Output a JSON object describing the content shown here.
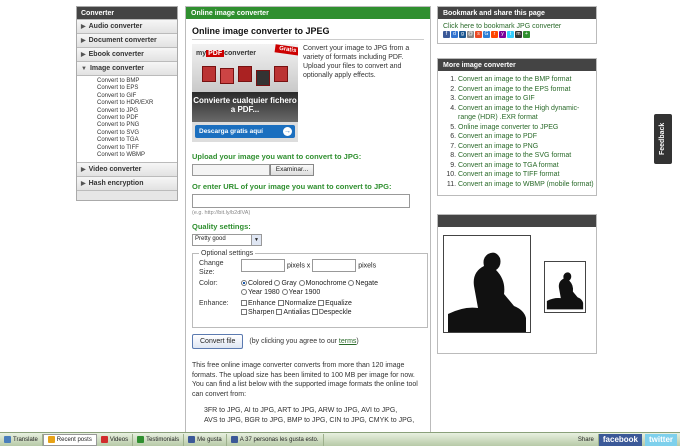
{
  "sidebar": {
    "header": "Converter",
    "items": [
      {
        "label": "Audio converter",
        "arrow": "▶"
      },
      {
        "label": "Document converter",
        "arrow": "▶"
      },
      {
        "label": "Ebook converter",
        "arrow": "▶"
      },
      {
        "label": "Image converter",
        "arrow": "▼"
      }
    ],
    "sub_items": [
      "Convert to BMP",
      "Convert to EPS",
      "Convert to GIF",
      "Convert to HDR/EXR",
      "Convert to JPG",
      "Convert to PDF",
      "Convert to PNG",
      "Convert to SVG",
      "Convert to TGA",
      "Convert to TIFF",
      "Convert to WBMP"
    ],
    "items_after": [
      {
        "label": "Video converter",
        "arrow": "▶"
      },
      {
        "label": "Hash encryption",
        "arrow": "▶"
      }
    ]
  },
  "main": {
    "header": "Online image converter",
    "title": "Online image converter to JPEG",
    "ad": {
      "logo_pre": "my",
      "logo_pdf": "PDF",
      "logo_post": "converter",
      "ribbon": "Gratis",
      "headline": "Convierte cualquier fichero a PDF...",
      "button": "Descarga gratis aquí",
      "button_icon": "→"
    },
    "promo_text": "Convert your image to JPG from a variety of formats including PDF. Upload your files to convert and optionally apply effects.",
    "upload_label": "Upload your image you want to convert to JPG:",
    "browse_button": "Examinar...",
    "url_label": "Or enter URL of your image you want to convert to JPG:",
    "url_hint": "(e.g. http://bit.ly/b2dlVA)",
    "quality_label": "Quality settings:",
    "quality_value": "Pretty good",
    "quality_arrow": "▼",
    "options": {
      "legend": "Optional settings",
      "change_size_label": "Change Size:",
      "pixels_x": "pixels x",
      "pixels": "pixels",
      "color_label": "Color:",
      "colors": [
        "Colored",
        "Gray",
        "Monochrome",
        "Negate",
        "Year 1980",
        "Year 1900"
      ],
      "enhance_label": "Enhance:",
      "enhance": [
        "Enhance",
        "Normalize",
        "Equalize",
        "Sharpen",
        "Antialias",
        "Despeckle"
      ]
    },
    "convert_button": "Convert file",
    "agree_pre": "(by clicking you agree to our",
    "agree_link": "terms",
    "agree_post": ")",
    "description": "This free online image converter converts from more than 120 image formats. The upload size has been limited to 100 MB per image for now. You can find a list below with the supported image formats the online tool can convert from:",
    "formats_line1": "3FR to JPG, AI to JPG, ART to JPG, ARW to JPG, AVI to JPG,",
    "formats_line2": "AVS to JPG, BGR to JPG, BMP to JPG, CIN to JPG, CMYK to JPG,"
  },
  "bookmark": {
    "header": "Bookmark and share this page",
    "text": "Click here to bookmark JPG converter",
    "icons": [
      {
        "name": "facebook-icon",
        "color": "#3b5998",
        "glyph": "f"
      },
      {
        "name": "delicious-icon",
        "color": "#3274d0",
        "glyph": "d"
      },
      {
        "name": "digg-icon",
        "color": "#1b5791",
        "glyph": "g"
      },
      {
        "name": "email-icon",
        "color": "#888888",
        "glyph": "@"
      },
      {
        "name": "stumbleupon-icon",
        "color": "#eb4924",
        "glyph": "s"
      },
      {
        "name": "google-icon",
        "color": "#2d7fd6",
        "glyph": "G"
      },
      {
        "name": "reddit-icon",
        "color": "#ff4500",
        "glyph": "r"
      },
      {
        "name": "yahoo-icon",
        "color": "#7b0099",
        "glyph": "y"
      },
      {
        "name": "twitter-icon",
        "color": "#33ccff",
        "glyph": "t"
      },
      {
        "name": "myspace-icon",
        "color": "#333333",
        "glyph": "m"
      },
      {
        "name": "share-icon",
        "color": "#2f8f2f",
        "glyph": "+"
      }
    ]
  },
  "more": {
    "header": "More image converter",
    "links": [
      "Convert an image to the BMP format",
      "Convert an image to the EPS format",
      "Convert an image to GIF",
      "Convert an image to the High dynamic-range (HDR) .EXR format",
      "Online image converter to JPEG",
      "Convert an image to PDF",
      "Convert an image to PNG",
      "Convert an image to the SVG format",
      "Convert an image to TGA format",
      "Convert an image to TIFF format",
      "Convert an image to WBMP (mobile format)"
    ]
  },
  "feedback": "Feedback",
  "bottombar": {
    "items": [
      {
        "label": "Translate",
        "color": "#4a7ebb"
      },
      {
        "label": "Recent posts",
        "color": "#e8a317",
        "active": true
      },
      {
        "label": "Videos",
        "color": "#d12c2c"
      },
      {
        "label": "Testimonials",
        "color": "#2f8f2f"
      },
      {
        "label": "Me gusta",
        "color": "#3b5998"
      },
      {
        "label": "A 37 personas les gusta esto.",
        "color": "#3b5998"
      }
    ],
    "share": "Share",
    "facebook": "facebook",
    "twitter": "twitter"
  }
}
